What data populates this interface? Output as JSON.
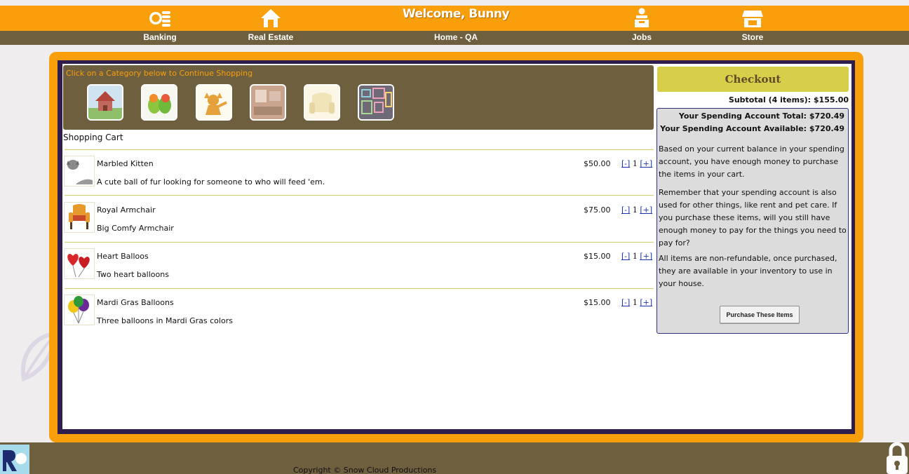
{
  "nav": {
    "welcome": "Welcome, Bunny",
    "items": [
      {
        "label": "Banking",
        "icon": "coins-icon"
      },
      {
        "label": "Real Estate",
        "icon": "house-icon"
      },
      {
        "label": "Home - QA",
        "icon": ""
      },
      {
        "label": "Jobs",
        "icon": "worker-icon"
      },
      {
        "label": "Store",
        "icon": "store-icon"
      }
    ]
  },
  "categories": {
    "hint": "Click on a Category below to Continue Shopping",
    "tiles": [
      "house-category-icon",
      "birds-category-icon",
      "cat-category-icon",
      "room-category-icon",
      "armchair-category-icon",
      "frames-category-icon"
    ]
  },
  "cart": {
    "title": "Shopping Cart",
    "items": [
      {
        "name": "Marbled Kitten",
        "description": "A cute ball of fur looking for someone to who will feed 'em.",
        "price": "$50.00",
        "qty": "1",
        "icon": "kitten-icon"
      },
      {
        "name": "Royal Armchair",
        "description": "Big Comfy Armchair",
        "price": "$75.00",
        "qty": "1",
        "icon": "armchair-icon"
      },
      {
        "name": "Heart Balloos",
        "description": "Two heart balloons",
        "price": "$15.00",
        "qty": "1",
        "icon": "heart-balloons-icon"
      },
      {
        "name": "Mardi Gras Balloons",
        "description": "Three balloons in Mardi Gras colors",
        "price": "$15.00",
        "qty": "1",
        "icon": "balloons-icon"
      }
    ],
    "minus_label": "[-]",
    "plus_label": "[+]"
  },
  "checkout": {
    "button_label": "Checkout",
    "subtotal": "Subtotal (4 items): $155.00",
    "account_total": "Your Spending Account Total: $720.49",
    "account_available": "Your Spending Account Available: $720.49",
    "para1": "Based on your current balance in your spending account, you have enough money to purchase the items in your cart.",
    "para2": "Remember that your spending account is also used for other things, like rent and pet care. If you purchase these items, will you still have enough money to pay for the things you need to pay for?",
    "para3": "All items are non-refundable, once purchased, they are available in your inventory to use in your house.",
    "purchase_label": "Purchase These Items"
  },
  "footer": {
    "copyright": "Copyright © Snow Cloud Productions"
  },
  "colors": {
    "accent": "#f99f0c",
    "brown": "#6e5f3f",
    "checkout": "#d7ce4a",
    "frame": "#2f1d4d"
  }
}
